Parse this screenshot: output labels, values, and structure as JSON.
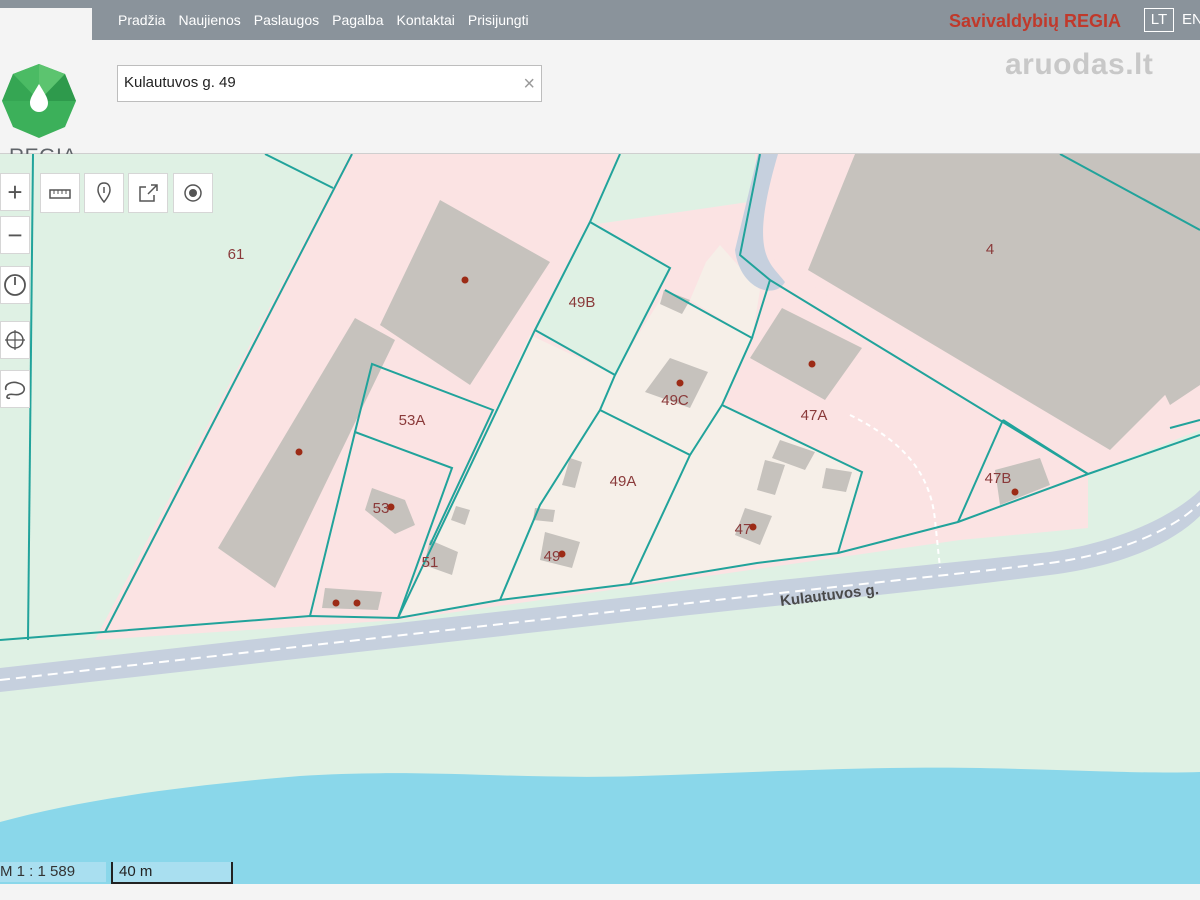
{
  "nav": {
    "items": [
      "Pradžia",
      "Naujienos",
      "Paslaugos",
      "Pagalba",
      "Kontaktai",
      "Prisijungti"
    ],
    "brand": "Savivaldybių REGIA",
    "lang_lt": "LT",
    "lang_en": "EN"
  },
  "logo": {
    "text": "REGIA"
  },
  "search": {
    "value": "Kulautuvos g. 49",
    "clear_icon": "×"
  },
  "watermark": "aruodas.lt",
  "tools": [
    "ruler-icon",
    "marker-icon",
    "share-icon",
    "target-icon"
  ],
  "zoom": {
    "in": "+",
    "out": "−"
  },
  "map": {
    "street_label": "Kulautuvos g.",
    "parcels": [
      "61",
      "49B",
      "4",
      "53A",
      "49C",
      "47A",
      "53",
      "49A",
      "47B",
      "51",
      "49",
      "47"
    ]
  },
  "scale": {
    "ratio": "M 1 : 1 589",
    "bar": "40 m"
  },
  "colors": {
    "parcel_line": "#21a39b",
    "pink_zone": "#fbe3e3",
    "green_zone": "#dff1e4",
    "water": "#8ad7ea",
    "building": "#c6c2bd"
  }
}
